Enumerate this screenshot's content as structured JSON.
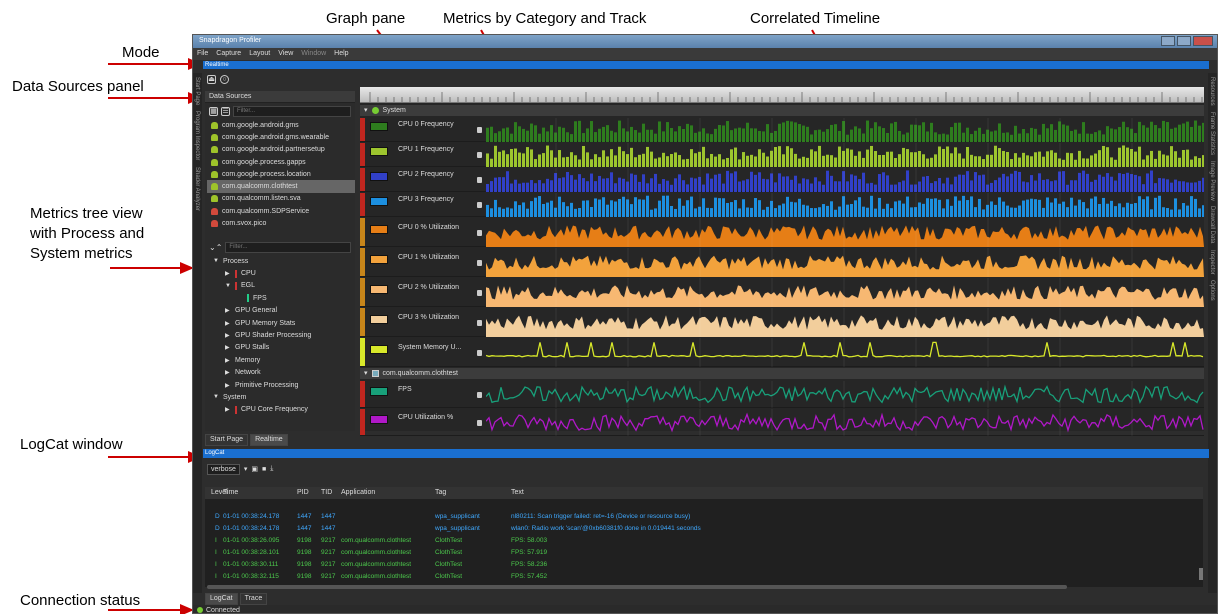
{
  "annotations": {
    "mode": "Mode",
    "data_sources_panel": "Data Sources panel",
    "metrics_tree": [
      "Metrics tree view",
      "with Process and",
      "System metrics"
    ],
    "logcat_window": "LogCat window",
    "connection_status": "Connection status",
    "graph_pane": "Graph pane",
    "metrics_by_category": "Metrics by Category and Track",
    "correlated_timeline": "Correlated Timeline"
  },
  "window": {
    "title": "Snapdragon Profiler",
    "menu": [
      "File",
      "Capture",
      "Layout",
      "View",
      "Window",
      "Help"
    ],
    "mode": "Realtime",
    "left_vtabs": [
      "Start Page",
      "Program Inspector",
      "Shader Analyzer"
    ],
    "right_vtabs": [
      "Resources",
      "Frame Statistics",
      "Image Preview",
      "Drawcall Data",
      "Inspector",
      "Options"
    ]
  },
  "data_sources": {
    "header": "Data Sources",
    "filter_placeholder": "Filter...",
    "items": [
      {
        "label": "com.google.android.gms",
        "icon": "android-icon"
      },
      {
        "label": "com.google.android.gms.wearable",
        "icon": "android-icon"
      },
      {
        "label": "com.google.android.partnersetup",
        "icon": "android-icon"
      },
      {
        "label": "com.google.process.gapps",
        "icon": "android-icon"
      },
      {
        "label": "com.google.process.location",
        "icon": "android-icon"
      },
      {
        "label": "com.qualcomm.clothtest",
        "icon": "android-icon",
        "selected": true
      },
      {
        "label": "com.qualcomm.listen.sva",
        "icon": "android-icon"
      },
      {
        "label": "com.qualcomm.SDPService",
        "icon": "app-icon"
      },
      {
        "label": "com.svox.pico",
        "icon": "app-icon"
      }
    ]
  },
  "metrics_tree": {
    "filter_placeholder": "Filter...",
    "items": [
      {
        "label": "Process",
        "level": 0,
        "expanded": true
      },
      {
        "label": "CPU",
        "level": 1,
        "mark": "red"
      },
      {
        "label": "EGL",
        "level": 1,
        "expanded": true,
        "mark": "red"
      },
      {
        "label": "FPS",
        "level": 2,
        "mark": "green"
      },
      {
        "label": "GPU General",
        "level": 1
      },
      {
        "label": "GPU Memory Stats",
        "level": 1
      },
      {
        "label": "GPU Shader Processing",
        "level": 1
      },
      {
        "label": "GPU Stalls",
        "level": 1
      },
      {
        "label": "Memory",
        "level": 1
      },
      {
        "label": "Network",
        "level": 1
      },
      {
        "label": "Primitive Processing",
        "level": 1
      },
      {
        "label": "System",
        "level": 0,
        "expanded": true
      },
      {
        "label": "CPU Core Frequency",
        "level": 1,
        "mark": "red"
      }
    ]
  },
  "graph": {
    "categories": [
      {
        "name": "System",
        "tracks": [
          {
            "label": "CPU 0 Frequency",
            "color": "#2e7d1e",
            "bar": "#c0261f"
          },
          {
            "label": "CPU 1 Frequency",
            "color": "#9dc52e",
            "bar": "#c0261f"
          },
          {
            "label": "CPU 2 Frequency",
            "color": "#3140c8",
            "bar": "#c0261f"
          },
          {
            "label": "CPU 3 Frequency",
            "color": "#1c8fe0",
            "bar": "#c0261f"
          },
          {
            "label": "CPU 0 % Utilization",
            "color": "#e67e16",
            "bar": "#c8861a"
          },
          {
            "label": "CPU 1 % Utilization",
            "color": "#f2a23c",
            "bar": "#c8861a"
          },
          {
            "label": "CPU 2 % Utilization",
            "color": "#f7b872",
            "bar": "#c8861a"
          },
          {
            "label": "CPU 3 % Utilization",
            "color": "#f2ce9c",
            "bar": "#c8861a"
          },
          {
            "label": "System Memory U...",
            "color": "#d8e82a",
            "bar": "#d8e82a"
          }
        ]
      },
      {
        "name": "com.qualcomm.clothtest",
        "tracks": [
          {
            "label": "FPS",
            "color": "#18a07a",
            "bar": "#c0261f"
          },
          {
            "label": "CPU Utilization %",
            "color": "#b018c8",
            "bar": "#c0261f"
          }
        ]
      }
    ]
  },
  "top_tabs": [
    "Start Page",
    "Realtime"
  ],
  "logcat": {
    "title": "LogCat",
    "level_select": "verbose",
    "columns": [
      "Level",
      "Time",
      "PID",
      "TID",
      "Application",
      "Tag",
      "Text"
    ],
    "rows": [
      {
        "level": "D",
        "time": "01-01 00:38:24.178",
        "pid": "1447",
        "tid": "1447",
        "app": "",
        "tag": "wpa_supplicant",
        "text": "nl80211: Scan trigger failed: ret=-16 (Device or resource busy)",
        "color": "#3fa9ff"
      },
      {
        "level": "D",
        "time": "01-01 00:38:24.178",
        "pid": "1447",
        "tid": "1447",
        "app": "",
        "tag": "wpa_supplicant",
        "text": "wlan0: Radio work 'scan'@0xb60381f0 done in 0.019441 seconds",
        "color": "#3fa9ff"
      },
      {
        "level": "I",
        "time": "01-01 00:38:26.095",
        "pid": "9198",
        "tid": "9217",
        "app": "com.qualcomm.clothtest",
        "tag": "ClothTest",
        "text": "FPS: 58.003",
        "color": "#4cc94c"
      },
      {
        "level": "I",
        "time": "01-01 00:38:28.101",
        "pid": "9198",
        "tid": "9217",
        "app": "com.qualcomm.clothtest",
        "tag": "ClothTest",
        "text": "FPS: 57.919",
        "color": "#4cc94c"
      },
      {
        "level": "I",
        "time": "01-01 00:38:30.111",
        "pid": "9198",
        "tid": "9217",
        "app": "com.qualcomm.clothtest",
        "tag": "ClothTest",
        "text": "FPS: 58.236",
        "color": "#4cc94c"
      },
      {
        "level": "I",
        "time": "01-01 00:38:32.115",
        "pid": "9198",
        "tid": "9217",
        "app": "com.qualcomm.clothtest",
        "tag": "ClothTest",
        "text": "FPS: 57.452",
        "color": "#4cc94c"
      }
    ]
  },
  "bottom_tabs": [
    "LogCat",
    "Trace"
  ],
  "status": "Connected"
}
